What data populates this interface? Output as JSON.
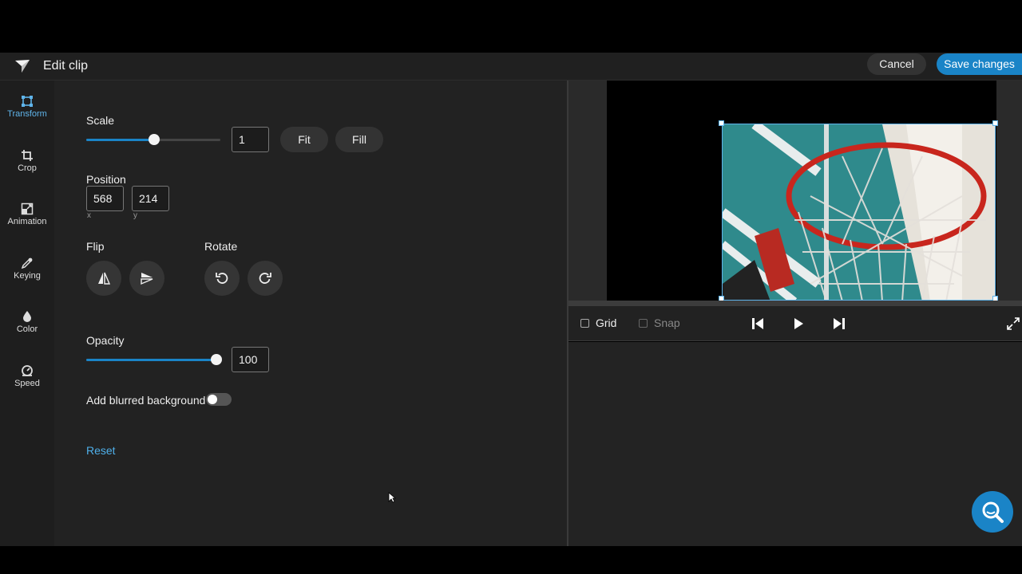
{
  "header": {
    "title": "Edit clip",
    "cancel_label": "Cancel",
    "save_label": "Save changes"
  },
  "sidenav": {
    "items": [
      {
        "label": "Transform",
        "icon": "transform-icon",
        "active": true
      },
      {
        "label": "Crop",
        "icon": "crop-icon"
      },
      {
        "label": "Animation",
        "icon": "animation-icon"
      },
      {
        "label": "Keying",
        "icon": "eyedropper-icon"
      },
      {
        "label": "Color",
        "icon": "droplet-icon"
      },
      {
        "label": "Speed",
        "icon": "speedometer-icon"
      }
    ]
  },
  "transform": {
    "scale": {
      "label": "Scale",
      "value": "1",
      "slider_level": 0.5,
      "fit_label": "Fit",
      "fill_label": "Fill"
    },
    "position": {
      "label": "Position",
      "x": "568",
      "y": "214",
      "x_label": "x",
      "y_label": "y"
    },
    "flip": {
      "label": "Flip"
    },
    "rotate": {
      "label": "Rotate"
    },
    "opacity": {
      "label": "Opacity",
      "value": "100",
      "slider_level": 1.0
    },
    "blur": {
      "label": "Add blurred background",
      "enabled": false
    },
    "reset_label": "Reset"
  },
  "preview": {
    "grid_label": "Grid",
    "snap_label": "Snap"
  },
  "colors": {
    "accent": "#1a84c7",
    "link": "#4fb0ea"
  }
}
